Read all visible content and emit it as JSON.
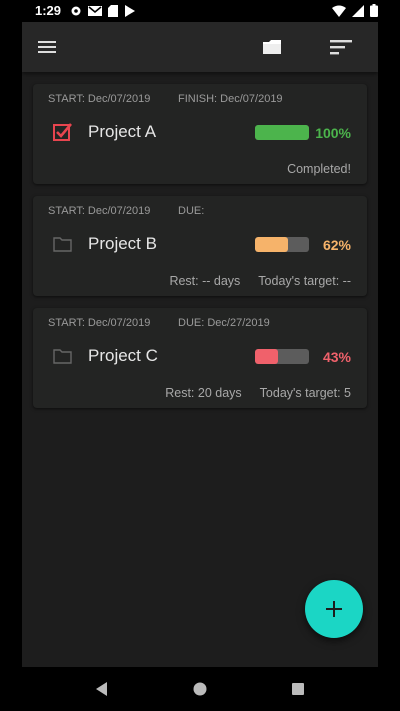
{
  "status_bar": {
    "time": "1:29",
    "left_icons": [
      "settings-icon",
      "gmail-icon",
      "sd-card-icon",
      "play-store-icon"
    ],
    "right_icons": [
      "wifi-icon",
      "signal-icon",
      "battery-icon"
    ]
  },
  "toolbar": {
    "icons": [
      "menu-icon",
      "archive-icon",
      "sort-icon"
    ]
  },
  "projects": [
    {
      "start": "START: Dec/07/2019",
      "end": "FINISH: Dec/07/2019",
      "name": "Project A",
      "status_icon": "checkbox-checked-icon",
      "progress": 1.0,
      "percent": "100%",
      "color": "#4cb44c",
      "footer": "Completed!"
    },
    {
      "start": "START: Dec/07/2019",
      "end": "DUE:",
      "name": "Project B",
      "status_icon": "folder-icon",
      "progress": 0.62,
      "percent": "62%",
      "color": "#f6b36a",
      "rest": "Rest: -- days",
      "target": "Today's target: --"
    },
    {
      "start": "START: Dec/07/2019",
      "end": "DUE: Dec/27/2019",
      "name": "Project C",
      "status_icon": "folder-icon",
      "progress": 0.43,
      "percent": "43%",
      "color": "#f0616b",
      "rest": "Rest: 20 days",
      "target": "Today's target: 5"
    }
  ],
  "fab": {
    "icon": "add-icon",
    "color": "#1bd6c5"
  },
  "nav_bar": {
    "icons": [
      "back-icon",
      "home-icon",
      "recents-icon"
    ]
  }
}
